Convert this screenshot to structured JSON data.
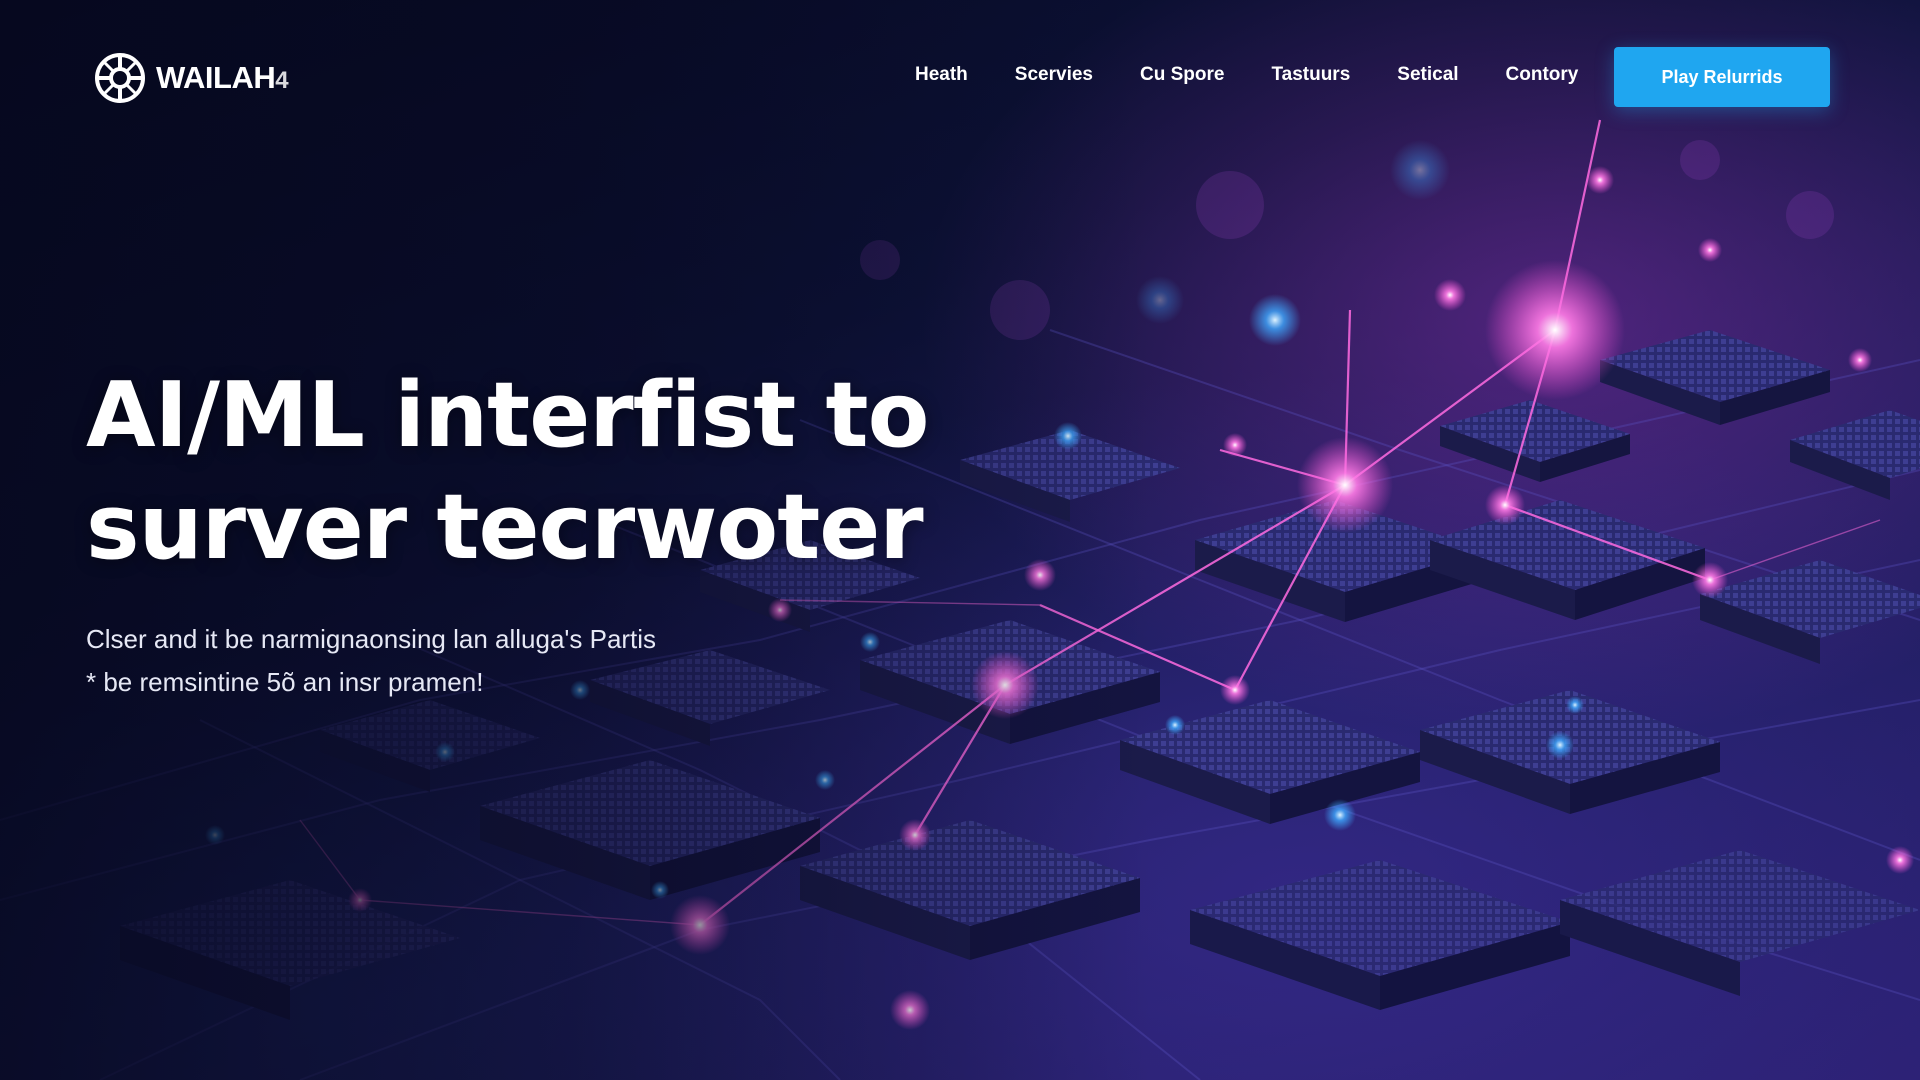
{
  "brand": {
    "name": "WAILAH",
    "badge": "4"
  },
  "nav": {
    "items": [
      "Heath",
      "Scervies",
      "Cu Spore",
      "Tastuurs",
      "Setical",
      "Contory"
    ],
    "cta_label": "Play Relurrids"
  },
  "hero": {
    "title_line1": "AI/ML interfist to",
    "title_line2": "surver tecrwoter",
    "subtitle_line1": "Clser and it be narmignaonsing lan alluga's Partis",
    "subtitle_line2": "* be remsintine 5õ an insr pramen!"
  },
  "colors": {
    "accent": "#1fa6f0",
    "background": "#0a0d2e",
    "glow_pink": "#ff4fd8",
    "glow_blue": "#3fa8ff"
  },
  "icons": {
    "logo": "circuit-gear-icon"
  }
}
